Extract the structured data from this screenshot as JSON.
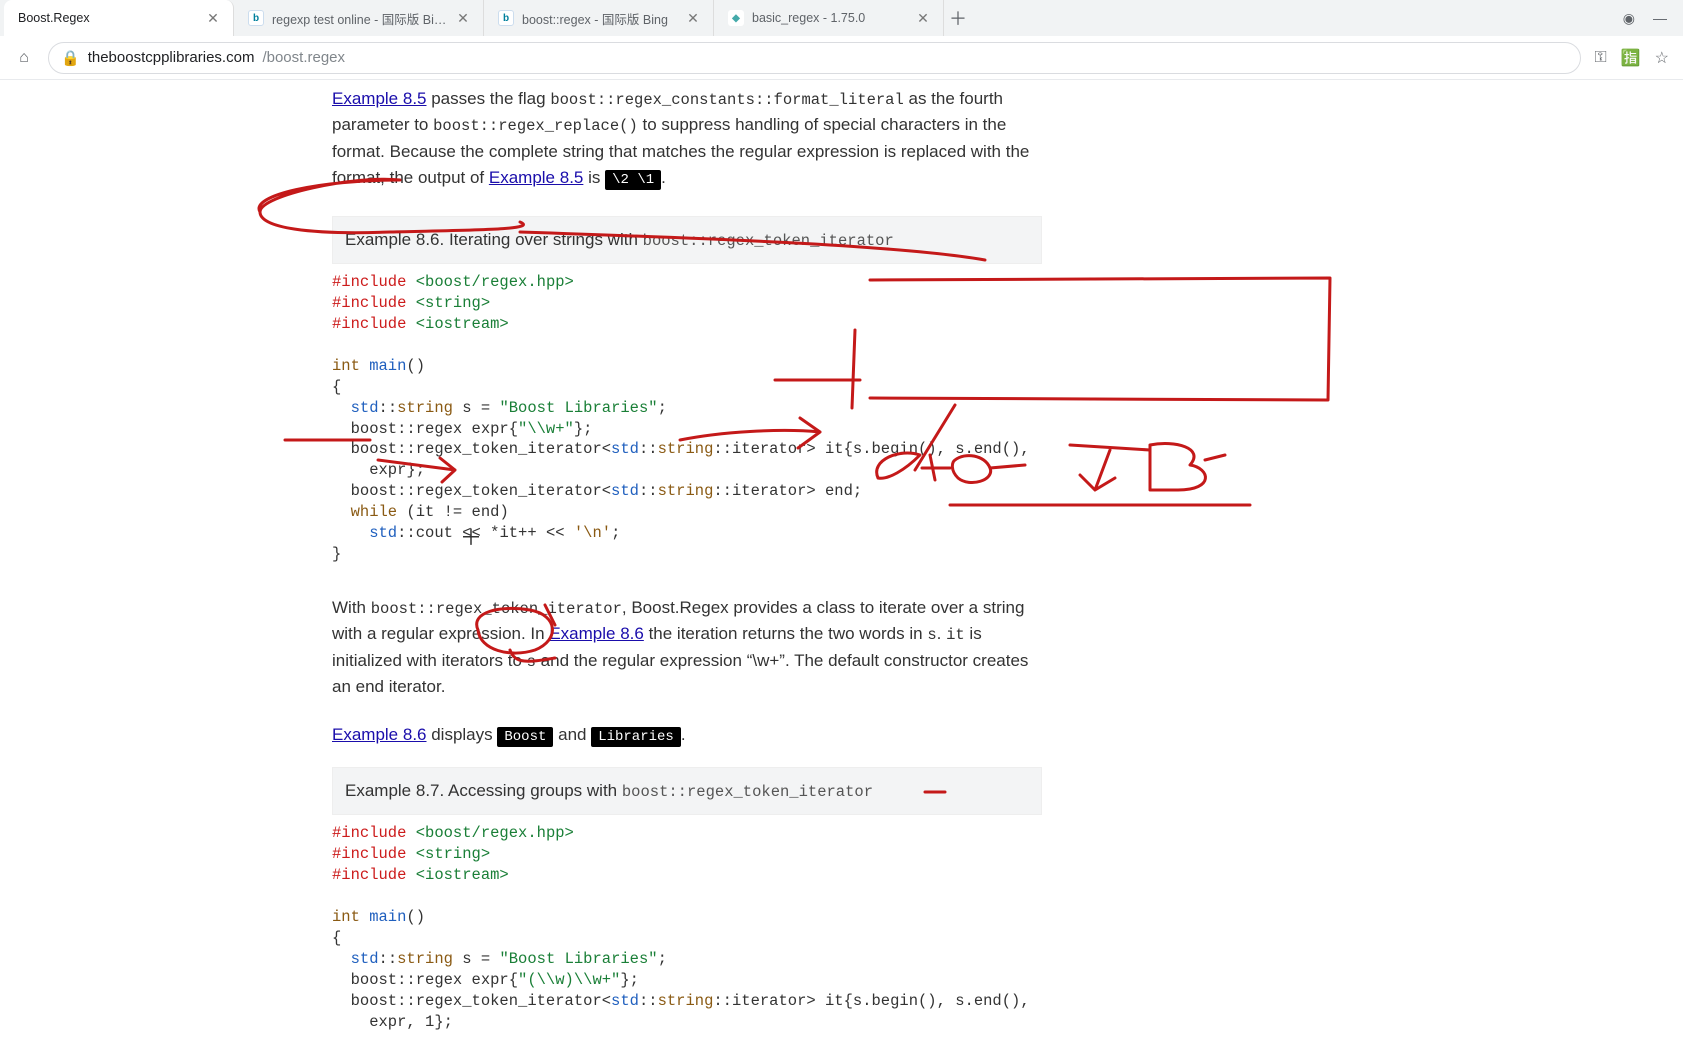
{
  "tabs": {
    "t0": {
      "title": "Boost.Regex"
    },
    "t1": {
      "title": "regexp test online - 国际版 Bing"
    },
    "t2": {
      "title": "boost::regex - 国际版 Bing"
    },
    "t3": {
      "title": "basic_regex - 1.75.0"
    }
  },
  "url": {
    "domain": "theboostcpplibraries.com",
    "path": "/boost.regex"
  },
  "paragraphs": {
    "p1_1": "Example 8.5",
    "p1_2": " passes the flag ",
    "p1_3": "boost::regex_constants::format_literal",
    "p1_4": " as the fourth parameter to ",
    "p1_5": "boost::regex_replace()",
    "p1_6": " to suppress handling of special characters in the format. Because the complete string that matches the regular expression is replaced with the format, the output of ",
    "p1_7": "Example 8.5",
    "p1_8": " is ",
    "p1_9": "\\2 \\1",
    "p1_10": ".",
    "ex86_pre": "Example 8.6. Iterating over strings with ",
    "ex86_code": "boost::regex_token_iterator",
    "p2_1": "With ",
    "p2_2": "boost::regex_token_iterator",
    "p2_3": ", Boost.Regex provides a class to iterate over a string with a regular expression. In ",
    "p2_4": "Example 8.6",
    "p2_5": " the iteration returns the two words in ",
    "p2_6": "s",
    "p2_7": ". ",
    "p2_8": "it",
    "p2_9": " is initialized with iterators to ",
    "p2_10": "s",
    "p2_11": " and the regular expression “\\w+”. The default constructor creates an end iterator.",
    "p3_1": "Example 8.6",
    "p3_2": " displays ",
    "p3_3": "Boost",
    "p3_4": " and ",
    "p3_5": "Libraries",
    "p3_6": ".",
    "ex87_pre": "Example 8.7. Accessing groups with ",
    "ex87_code": "boost::regex_token_iterator"
  },
  "code86": {
    "l1a": "#include",
    "l1b": " <boost/regex.hpp>",
    "l2a": "#include",
    "l2b": " <string>",
    "l3a": "#include",
    "l3b": " <iostream>",
    "l4": "",
    "l5a": "int",
    "l5b": " main",
    "l5c": "()",
    "l6": "{",
    "l7a": "  std",
    "l7b": "::",
    "l7c": "string",
    "l7d": " s = ",
    "l7e": "\"Boost Libraries\"",
    "l7f": ";",
    "l8a": "  boost::regex expr{",
    "l8b": "\"\\\\w+\"",
    "l8c": "};",
    "l9a": "  boost::regex_token_iterator<",
    "l9b": "std",
    "l9c": "::",
    "l9d": "string",
    "l9e": "::iterator> it{s.begin(), s.end(),",
    "l10": "    expr};",
    "l11a": "  boost::regex_token_iterator<",
    "l11b": "std",
    "l11c": "::",
    "l11d": "string",
    "l11e": "::iterator> end;",
    "l12a": "  while",
    "l12b": " (it != end)",
    "l13a": "    std",
    "l13b": "::cout << *it++ << ",
    "l13c": "'\\n'",
    "l13d": ";",
    "l14": "}"
  },
  "code87": {
    "l1a": "#include",
    "l1b": " <boost/regex.hpp>",
    "l2a": "#include",
    "l2b": " <string>",
    "l3a": "#include",
    "l3b": " <iostream>",
    "l4": "",
    "l5a": "int",
    "l5b": " main",
    "l5c": "()",
    "l6": "{",
    "l7a": "  std",
    "l7b": "::",
    "l7c": "string",
    "l7d": " s = ",
    "l7e": "\"Boost Libraries\"",
    "l7f": ";",
    "l8a": "  boost::regex expr{",
    "l8b": "\"(\\\\w)\\\\w+\"",
    "l8c": "};",
    "l9a": "  boost::regex_token_iterator<",
    "l9b": "std",
    "l9c": "::",
    "l9d": "string",
    "l9e": "::iterator> it{s.begin(), s.end(),",
    "l10": "    expr, 1};"
  }
}
